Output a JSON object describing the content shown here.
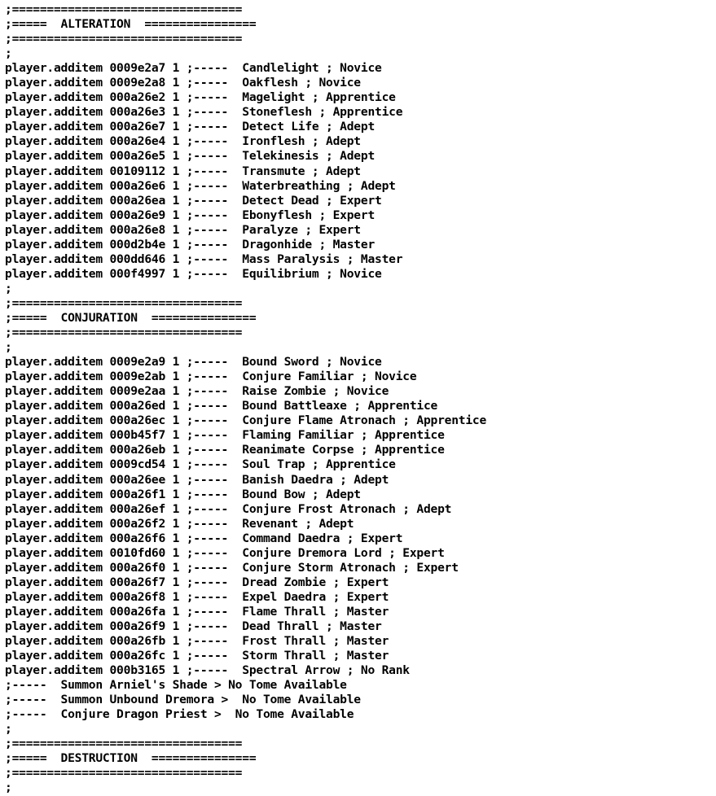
{
  "document": {
    "type": "console-command-script",
    "language": "skyrim-console-batch",
    "comment_prefix": ";",
    "command_prefix": "player.additem",
    "quantity": "1",
    "comment_separator": ";-----",
    "sections": [
      {
        "id": "alteration",
        "name": "ALTERATION",
        "divider_top": ";=================================",
        "header": ";=====  ALTERATION  ================",
        "divider_bottom": ";=================================",
        "spacer": ";",
        "entries": [
          {
            "command": "player.additem",
            "id": "0009e2a7",
            "qty": "1",
            "sep": ";-----",
            "spell": "Candlelight",
            "rank": "Novice"
          },
          {
            "command": "player.additem",
            "id": "0009e2a8",
            "qty": "1",
            "sep": ";-----",
            "spell": "Oakflesh",
            "rank": "Novice"
          },
          {
            "command": "player.additem",
            "id": "000a26e2",
            "qty": "1",
            "sep": ";-----",
            "spell": "Magelight",
            "rank": "Apprentice"
          },
          {
            "command": "player.additem",
            "id": "000a26e3",
            "qty": "1",
            "sep": ";-----",
            "spell": "Stoneflesh",
            "rank": "Apprentice"
          },
          {
            "command": "player.additem",
            "id": "000a26e7",
            "qty": "1",
            "sep": ";-----",
            "spell": "Detect Life",
            "rank": "Adept"
          },
          {
            "command": "player.additem",
            "id": "000a26e4",
            "qty": "1",
            "sep": ";-----",
            "spell": "Ironflesh",
            "rank": "Adept"
          },
          {
            "command": "player.additem",
            "id": "000a26e5",
            "qty": "1",
            "sep": ";-----",
            "spell": "Telekinesis",
            "rank": "Adept"
          },
          {
            "command": "player.additem",
            "id": "00109112",
            "qty": "1",
            "sep": ";-----",
            "spell": "Transmute",
            "rank": "Adept"
          },
          {
            "command": "player.additem",
            "id": "000a26e6",
            "qty": "1",
            "sep": ";-----",
            "spell": "Waterbreathing",
            "rank": "Adept"
          },
          {
            "command": "player.additem",
            "id": "000a26ea",
            "qty": "1",
            "sep": ";-----",
            "spell": "Detect Dead",
            "rank": "Expert"
          },
          {
            "command": "player.additem",
            "id": "000a26e9",
            "qty": "1",
            "sep": ";-----",
            "spell": "Ebonyflesh",
            "rank": "Expert"
          },
          {
            "command": "player.additem",
            "id": "000a26e8",
            "qty": "1",
            "sep": ";-----",
            "spell": "Paralyze",
            "rank": "Expert"
          },
          {
            "command": "player.additem",
            "id": "000d2b4e",
            "qty": "1",
            "sep": ";-----",
            "spell": "Dragonhide",
            "rank": "Master"
          },
          {
            "command": "player.additem",
            "id": "000dd646",
            "qty": "1",
            "sep": ";-----",
            "spell": "Mass Paralysis",
            "rank": "Master"
          },
          {
            "command": "player.additem",
            "id": "000f4997",
            "qty": "1",
            "sep": ";-----",
            "spell": "Equilibrium",
            "rank": "Novice"
          }
        ],
        "notes": []
      },
      {
        "id": "conjuration",
        "name": "CONJURATION",
        "divider_top": ";=================================",
        "header": ";=====  CONJURATION  ===============",
        "divider_bottom": ";=================================",
        "spacer": ";",
        "entries": [
          {
            "command": "player.additem",
            "id": "0009e2a9",
            "qty": "1",
            "sep": ";-----",
            "spell": "Bound Sword",
            "rank": "Novice"
          },
          {
            "command": "player.additem",
            "id": "0009e2ab",
            "qty": "1",
            "sep": ";-----",
            "spell": "Conjure Familiar",
            "rank": "Novice"
          },
          {
            "command": "player.additem",
            "id": "0009e2aa",
            "qty": "1",
            "sep": ";-----",
            "spell": "Raise Zombie",
            "rank": "Novice"
          },
          {
            "command": "player.additem",
            "id": "000a26ed",
            "qty": "1",
            "sep": ";-----",
            "spell": "Bound Battleaxe",
            "rank": "Apprentice"
          },
          {
            "command": "player.additem",
            "id": "000a26ec",
            "qty": "1",
            "sep": ";-----",
            "spell": "Conjure Flame Atronach",
            "rank": "Apprentice"
          },
          {
            "command": "player.additem",
            "id": "000b45f7",
            "qty": "1",
            "sep": ";-----",
            "spell": "Flaming Familiar",
            "rank": "Apprentice"
          },
          {
            "command": "player.additem",
            "id": "000a26eb",
            "qty": "1",
            "sep": ";-----",
            "spell": "Reanimate Corpse",
            "rank": "Apprentice"
          },
          {
            "command": "player.additem",
            "id": "0009cd54",
            "qty": "1",
            "sep": ";-----",
            "spell": "Soul Trap",
            "rank": "Apprentice"
          },
          {
            "command": "player.additem",
            "id": "000a26ee",
            "qty": "1",
            "sep": ";-----",
            "spell": "Banish Daedra",
            "rank": "Adept"
          },
          {
            "command": "player.additem",
            "id": "000a26f1",
            "qty": "1",
            "sep": ";-----",
            "spell": "Bound Bow",
            "rank": "Adept"
          },
          {
            "command": "player.additem",
            "id": "000a26ef",
            "qty": "1",
            "sep": ";-----",
            "spell": "Conjure Frost Atronach",
            "rank": "Adept"
          },
          {
            "command": "player.additem",
            "id": "000a26f2",
            "qty": "1",
            "sep": ";-----",
            "spell": "Revenant",
            "rank": "Adept"
          },
          {
            "command": "player.additem",
            "id": "000a26f6",
            "qty": "1",
            "sep": ";-----",
            "spell": "Command Daedra",
            "rank": "Expert"
          },
          {
            "command": "player.additem",
            "id": "0010fd60",
            "qty": "1",
            "sep": ";-----",
            "spell": "Conjure Dremora Lord",
            "rank": "Expert"
          },
          {
            "command": "player.additem",
            "id": "000a26f0",
            "qty": "1",
            "sep": ";-----",
            "spell": "Conjure Storm Atronach",
            "rank": "Expert"
          },
          {
            "command": "player.additem",
            "id": "000a26f7",
            "qty": "1",
            "sep": ";-----",
            "spell": "Dread Zombie",
            "rank": "Expert"
          },
          {
            "command": "player.additem",
            "id": "000a26f8",
            "qty": "1",
            "sep": ";-----",
            "spell": "Expel Daedra",
            "rank": "Expert"
          },
          {
            "command": "player.additem",
            "id": "000a26fa",
            "qty": "1",
            "sep": ";-----",
            "spell": "Flame Thrall",
            "rank": "Master"
          },
          {
            "command": "player.additem",
            "id": "000a26f9",
            "qty": "1",
            "sep": ";-----",
            "spell": "Dead Thrall",
            "rank": "Master"
          },
          {
            "command": "player.additem",
            "id": "000a26fb",
            "qty": "1",
            "sep": ";-----",
            "spell": "Frost Thrall",
            "rank": "Master"
          },
          {
            "command": "player.additem",
            "id": "000a26fc",
            "qty": "1",
            "sep": ";-----",
            "spell": "Storm Thrall",
            "rank": "Master"
          },
          {
            "command": "player.additem",
            "id": "000b3165",
            "qty": "1",
            "sep": ";-----",
            "spell": "Spectral Arrow",
            "rank": "No Rank"
          }
        ],
        "notes": [
          ";-----  Summon Arniel's Shade > No Tome Available",
          ";-----  Summon Unbound Dremora >  No Tome Available",
          ";-----  Conjure Dragon Priest >  No Tome Available"
        ]
      },
      {
        "id": "destruction",
        "name": "DESTRUCTION",
        "divider_top": ";=================================",
        "header": ";=====  DESTRUCTION  ===============",
        "divider_bottom": ";=================================",
        "spacer": ";",
        "entries": [],
        "notes": []
      }
    ]
  },
  "colors": {
    "background": "#ffffff",
    "text": "#000000"
  }
}
